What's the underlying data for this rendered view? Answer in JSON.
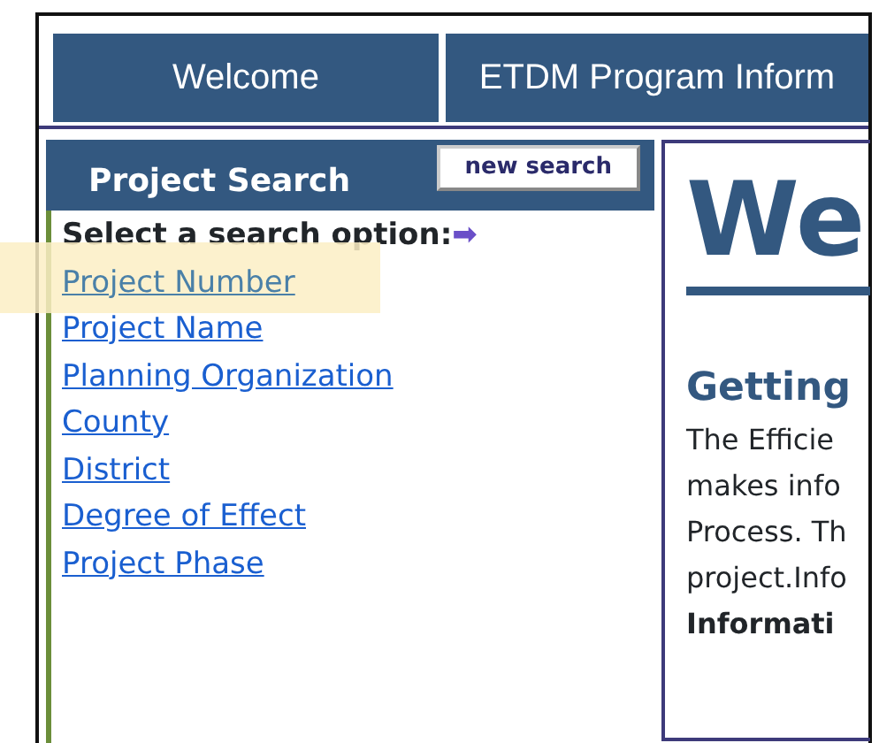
{
  "tabs": [
    {
      "label": "Welcome"
    },
    {
      "label": "ETDM Program Inform"
    }
  ],
  "search_panel": {
    "title": "Project Search",
    "new_search_button": "new search",
    "prompt": "Select a search option:",
    "arrow": "➡",
    "options": [
      {
        "label": "Project Number",
        "highlighted": true
      },
      {
        "label": "Project Name",
        "highlighted": false
      },
      {
        "label": "Planning Organization",
        "highlighted": false
      },
      {
        "label": "County",
        "highlighted": false
      },
      {
        "label": "District",
        "highlighted": false
      },
      {
        "label": "Degree of Effect",
        "highlighted": false
      },
      {
        "label": "Project Phase",
        "highlighted": false
      }
    ]
  },
  "content": {
    "heading": "We",
    "subheading": "Getting",
    "paragraph_lines": [
      {
        "text": "The Efficie",
        "bold": false
      },
      {
        "text": "makes info",
        "bold": false
      },
      {
        "text": "Process. Th",
        "bold": false
      },
      {
        "text": "project.Info",
        "bold": false
      },
      {
        "text": "Informati",
        "bold": true
      }
    ]
  }
}
